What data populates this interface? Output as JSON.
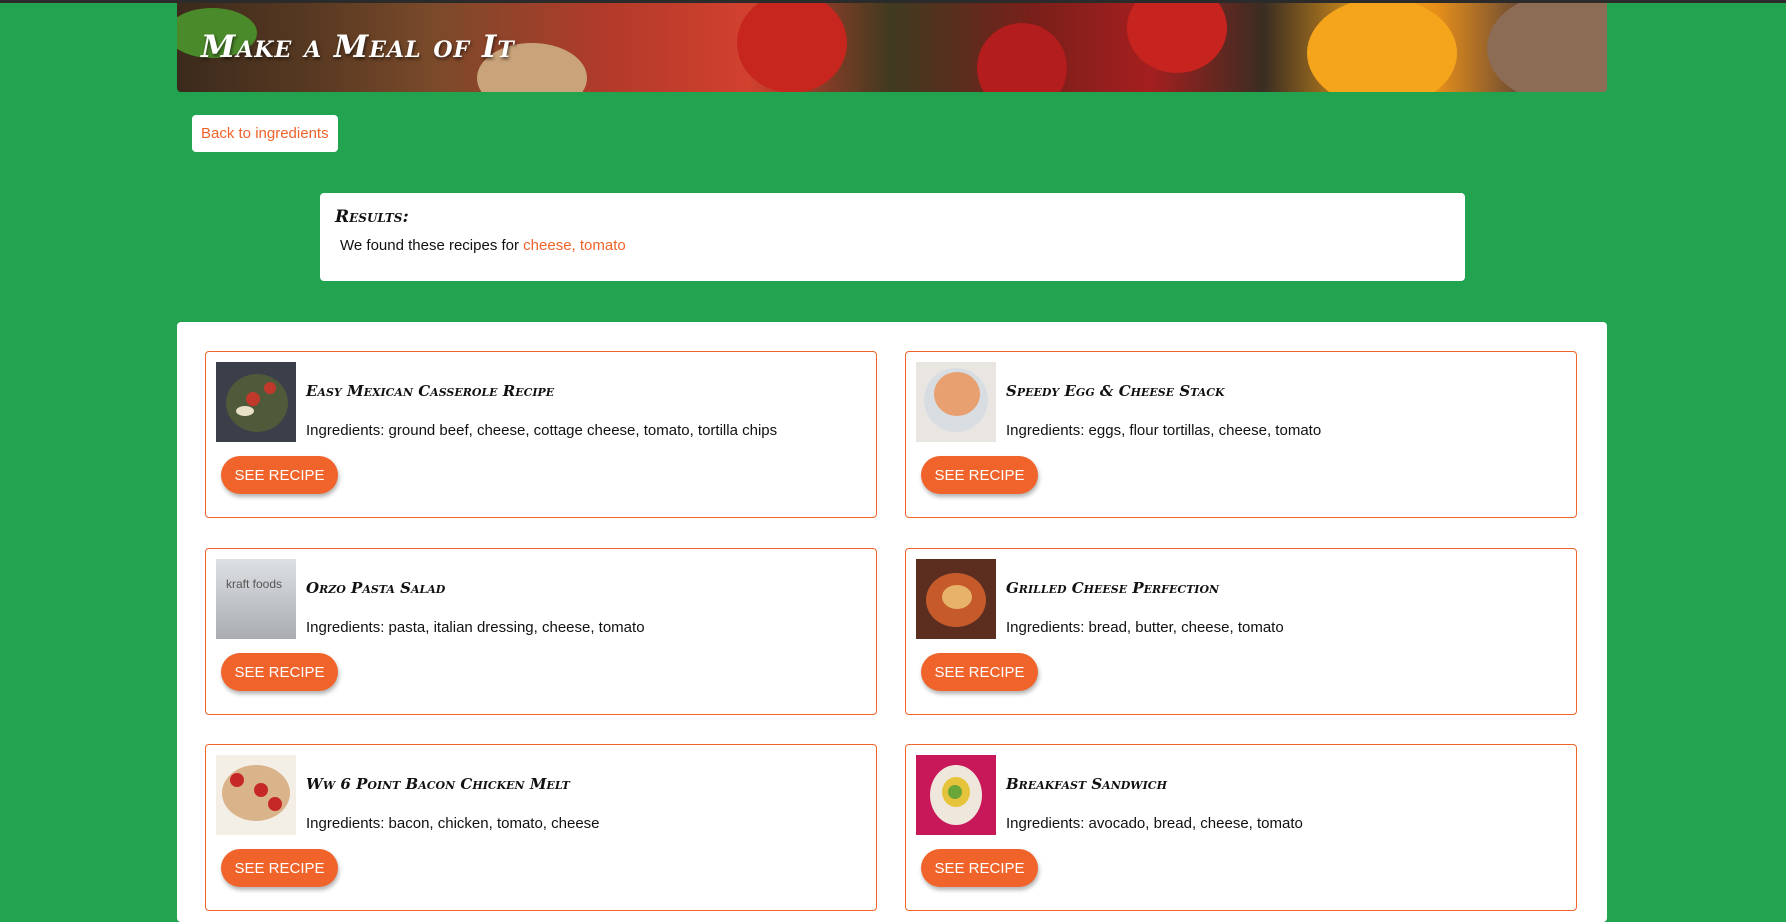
{
  "header": {
    "title": "Make a Meal of It"
  },
  "nav": {
    "back_label": "Back to ingredients"
  },
  "results": {
    "heading": "Results:",
    "intro": "We found these recipes for",
    "terms": "cheese, tomato"
  },
  "recipes": [
    {
      "title": "Easy Mexican Casserole Recipe",
      "ingredients": "Ingredients: ground beef, cheese, cottage cheese, tomato, tortilla chips",
      "button": "SEE RECIPE"
    },
    {
      "title": "Speedy Egg & Cheese Stack",
      "ingredients": "Ingredients: eggs, flour tortillas, cheese, tomato",
      "button": "SEE RECIPE"
    },
    {
      "title": "Orzo Pasta Salad",
      "ingredients": "Ingredients: pasta, italian dressing, cheese, tomato",
      "button": "SEE RECIPE",
      "thumb_text": "kraft foods"
    },
    {
      "title": "Grilled Cheese Perfection",
      "ingredients": "Ingredients: bread, butter, cheese, tomato",
      "button": "SEE RECIPE"
    },
    {
      "title": "Ww 6 Point Bacon Chicken Melt",
      "ingredients": "Ingredients: bacon, chicken, tomato, cheese",
      "button": "SEE RECIPE"
    },
    {
      "title": "Breakfast Sandwich",
      "ingredients": "Ingredients: avocado, bread, cheese, tomato",
      "button": "SEE RECIPE"
    }
  ],
  "colors": {
    "background": "#22a34f",
    "accent": "#f0632a",
    "panel": "#ffffff"
  }
}
